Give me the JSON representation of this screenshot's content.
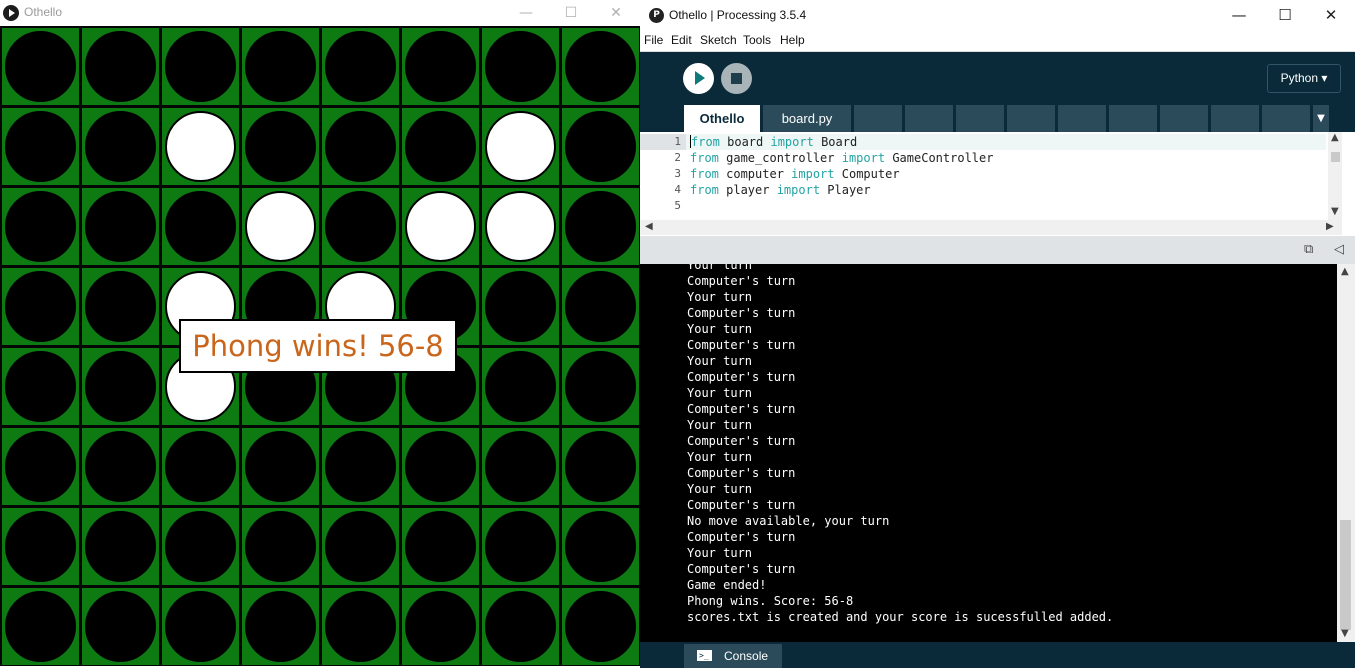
{
  "sketch": {
    "title": "Othello",
    "min_glyph": "—",
    "max_glyph": "☐",
    "close_glyph": "✕",
    "board": [
      [
        "B",
        "B",
        "B",
        "B",
        "B",
        "B",
        "B",
        "B"
      ],
      [
        "B",
        "B",
        "W",
        "B",
        "B",
        "B",
        "W",
        "B"
      ],
      [
        "B",
        "B",
        "B",
        "W",
        "B",
        "W",
        "W",
        "B"
      ],
      [
        "B",
        "B",
        "W",
        "B",
        "W",
        "B",
        "B",
        "B"
      ],
      [
        "B",
        "B",
        "W",
        "B",
        "B",
        "B",
        "B",
        "B"
      ],
      [
        "B",
        "B",
        "B",
        "B",
        "B",
        "B",
        "B",
        "B"
      ],
      [
        "B",
        "B",
        "B",
        "B",
        "B",
        "B",
        "B",
        "B"
      ],
      [
        "B",
        "B",
        "B",
        "B",
        "B",
        "B",
        "B",
        "B"
      ]
    ],
    "win_message": "Phong wins! 56-8",
    "colors": {
      "board_green": "#0e7a12",
      "message": "#c9661b"
    }
  },
  "ide": {
    "icon_letter": "P",
    "title": "Othello | Processing 3.5.4",
    "min_glyph": "—",
    "max_glyph": "☐",
    "close_glyph": "✕",
    "menu": [
      "File",
      "Edit",
      "Sketch",
      "Tools",
      "Help"
    ],
    "mode": "Python ▾",
    "tabs": {
      "active": "Othello",
      "second": "board.py",
      "menu_glyph": "▼"
    },
    "editor": {
      "lines": [
        {
          "no": "1",
          "kw1": "from",
          "mod": " board ",
          "kw2": "import",
          "name": " Board"
        },
        {
          "no": "2",
          "kw1": "from",
          "mod": " game_controller ",
          "kw2": "import",
          "name": " GameController"
        },
        {
          "no": "3",
          "kw1": "from",
          "mod": " computer ",
          "kw2": "import",
          "name": " Computer"
        },
        {
          "no": "4",
          "kw1": "from",
          "mod": " player ",
          "kw2": "import",
          "name": " Player"
        },
        {
          "no": "5",
          "kw1": "",
          "mod": "",
          "kw2": "",
          "name": ""
        }
      ]
    },
    "console": {
      "lines": [
        "Your turn",
        "Computer's turn",
        "Your turn",
        "Computer's turn",
        "Your turn",
        "Computer's turn",
        "Your turn",
        "Computer's turn",
        "Your turn",
        "Computer's turn",
        "Your turn",
        "Computer's turn",
        "Your turn",
        "Computer's turn",
        "Your turn",
        "Computer's turn",
        "No move available, your turn",
        "Computer's turn",
        "Your turn",
        "Computer's turn",
        "Game ended!",
        "Phong wins. Score: 56-8",
        "scores.txt is created and your score is sucessfulled added."
      ],
      "tab_label": "Console",
      "icon_text": ">_"
    },
    "colors": {
      "toolbar": "#0a2a3a",
      "tab": "#2b4b5a",
      "keyword": "#24a3a3"
    }
  }
}
